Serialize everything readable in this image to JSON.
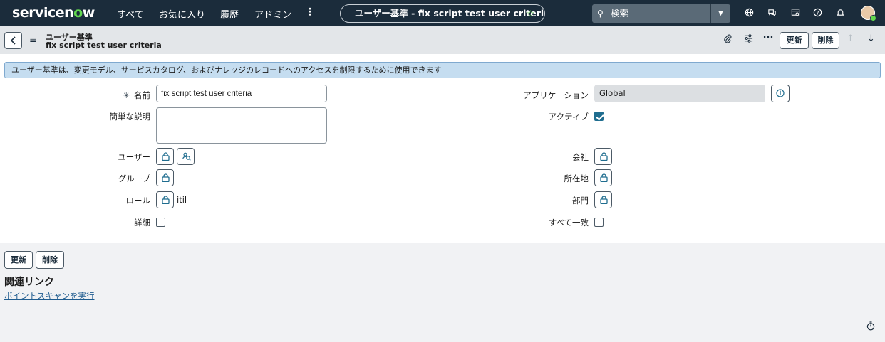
{
  "nav": {
    "logo_pre": "servicen",
    "logo_o": "o",
    "logo_post": "w",
    "menu": [
      "すべて",
      "お気に入り",
      "履歴",
      "アドミン"
    ],
    "record_title": "ユーザー基準 - fix script test user criteria",
    "search_placeholder": "検索"
  },
  "header": {
    "table_label": "ユーザー基準",
    "record_name": "fix script test user criteria",
    "update_label": "更新",
    "delete_label": "削除"
  },
  "info_message": "ユーザー基準は、変更モデル、サービスカタログ、およびナレッジのレコードへのアクセスを制限するために使用できます",
  "form": {
    "name_label": "名前",
    "name_value": "fix script test user criteria",
    "short_desc_label": "簡単な説明",
    "short_desc_value": "",
    "application_label": "アプリケーション",
    "application_value": "Global",
    "active_label": "アクティブ",
    "active_checked": true,
    "user_label": "ユーザー",
    "group_label": "グループ",
    "role_label": "ロール",
    "role_value": "itil",
    "advanced_label": "詳細",
    "advanced_checked": false,
    "company_label": "会社",
    "location_label": "所在地",
    "department_label": "部門",
    "match_all_label": "すべて一致",
    "match_all_checked": false
  },
  "footer": {
    "update_label": "更新",
    "delete_label": "削除",
    "related_links_title": "関連リンク",
    "related_link": "ポイントスキャンを実行"
  },
  "colors": {
    "nav_bg": "#1b2c3b",
    "accent_green": "#62d84e",
    "info_bg": "#c5ddf0",
    "checkbox_on": "#1f6d8f"
  }
}
